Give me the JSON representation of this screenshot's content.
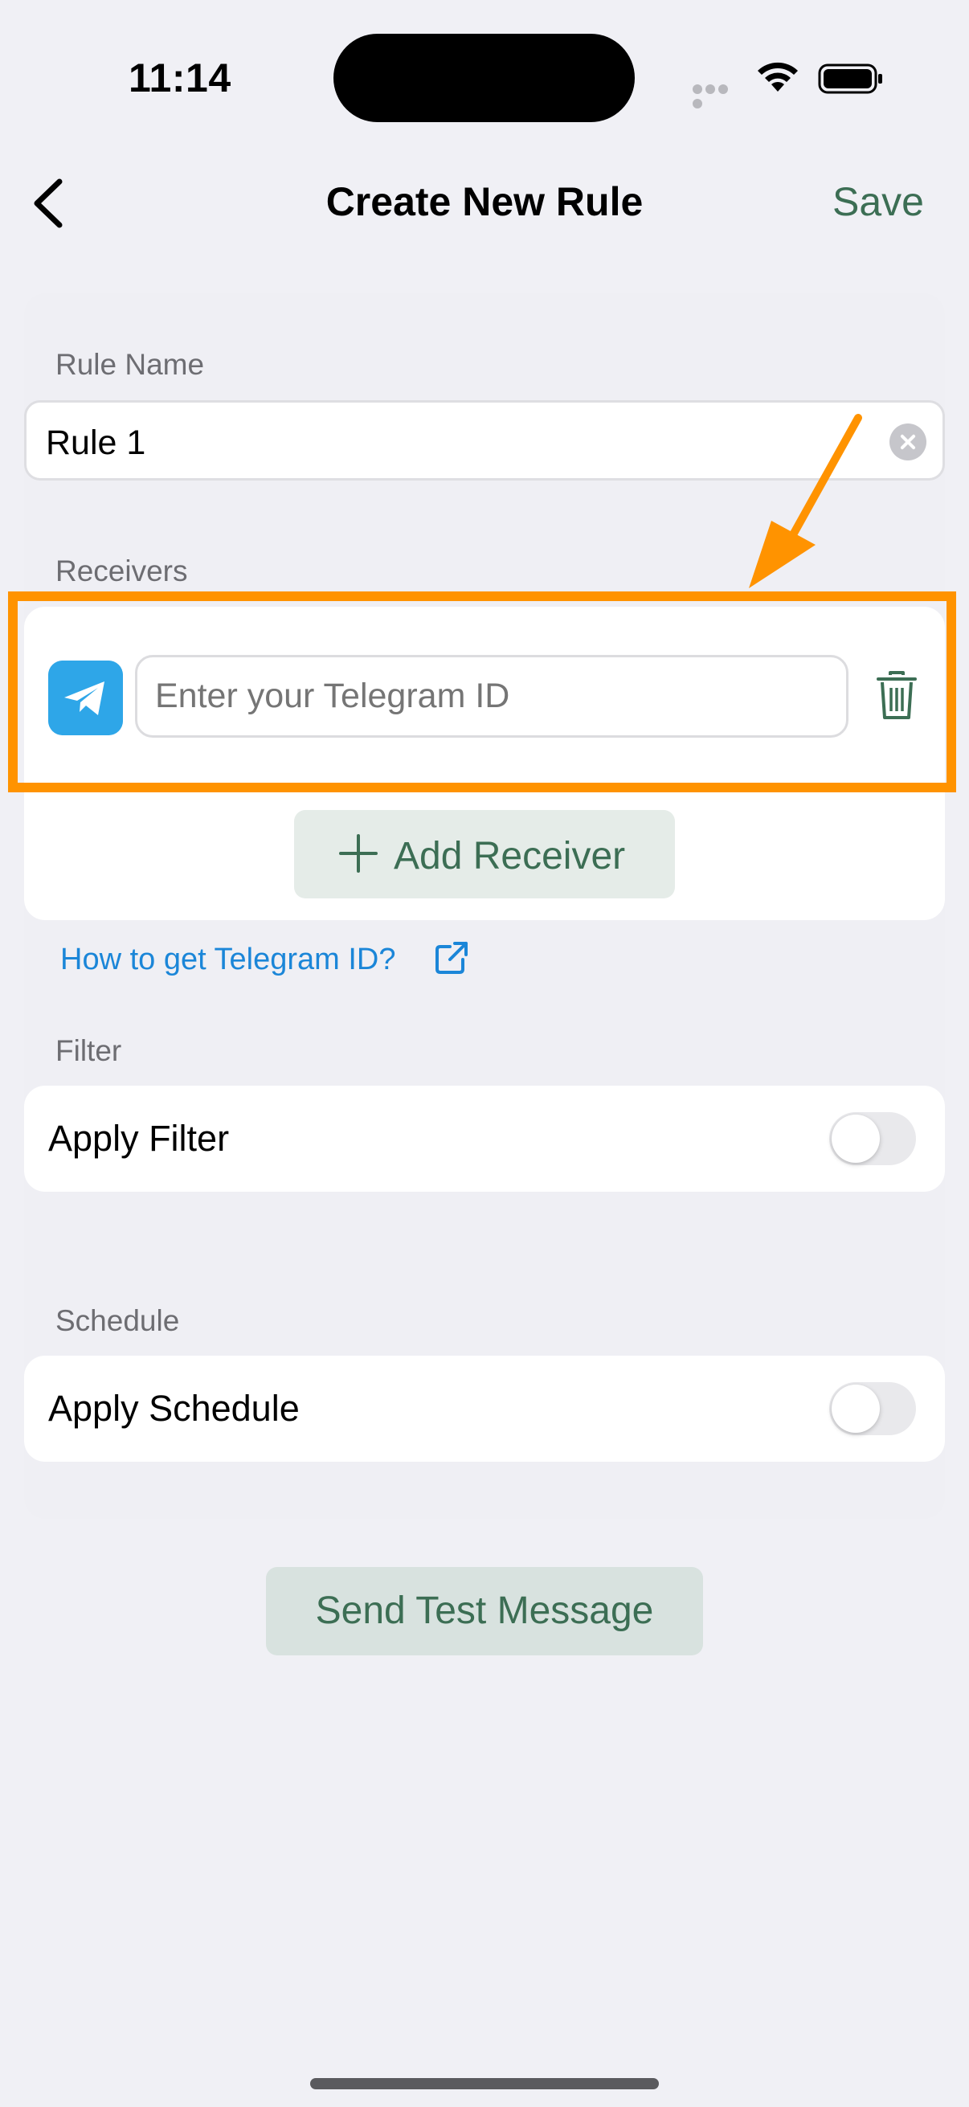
{
  "status_bar": {
    "time": "11:14"
  },
  "nav": {
    "title": "Create New Rule",
    "save_label": "Save"
  },
  "rule_name": {
    "label": "Rule Name",
    "value": "Rule 1"
  },
  "receivers": {
    "label": "Receivers",
    "input_placeholder": "Enter your Telegram ID",
    "input_value": "",
    "add_label": "Add Receiver",
    "help_link": "How to get Telegram ID?"
  },
  "filter": {
    "label": "Filter",
    "row_label": "Apply Filter",
    "enabled": false
  },
  "schedule": {
    "label": "Schedule",
    "row_label": "Apply Schedule",
    "enabled": false
  },
  "test_button": {
    "label": "Send Test Message"
  },
  "colors": {
    "accent": "#3c6e54",
    "link": "#1b86d8",
    "telegram": "#2ea6e8",
    "highlight": "#ff9300"
  },
  "icons": [
    "back-chevron-icon",
    "clear-icon",
    "telegram-icon",
    "trash-icon",
    "plus-icon",
    "external-link-icon",
    "wifi-icon",
    "battery-icon",
    "arrow-annotation-icon"
  ]
}
